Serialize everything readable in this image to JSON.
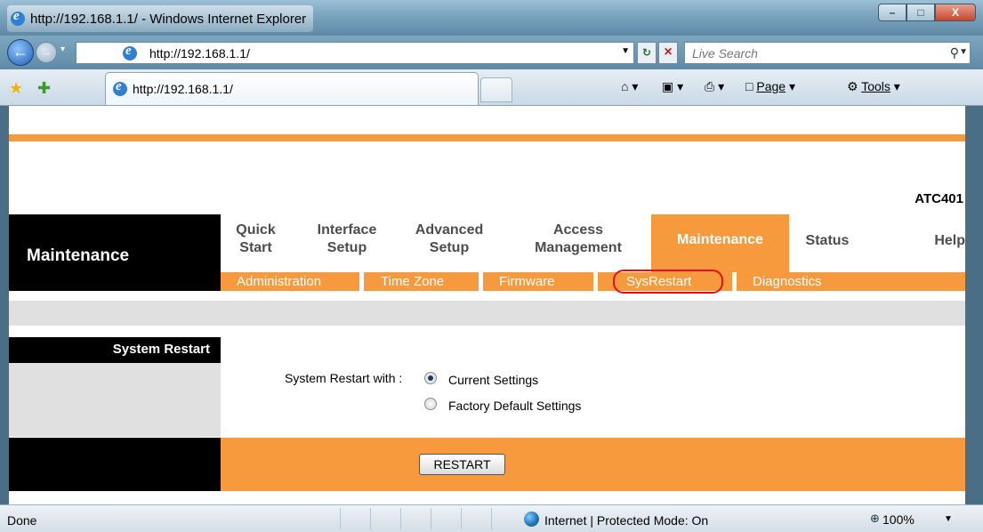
{
  "window": {
    "title": "http://192.168.1.1/ - Windows Internet Explorer",
    "btn_min": "–",
    "btn_max": "□",
    "btn_close": "X"
  },
  "address_bar": {
    "url": "http://192.168.1.1/",
    "search_placeholder": "Live Search"
  },
  "tab": {
    "label": "http://192.168.1.1/"
  },
  "command_bar": {
    "page": "Page",
    "tools": "Tools"
  },
  "router": {
    "model": "ATC401",
    "section": "Maintenance",
    "menu": [
      {
        "label": "Quick Start"
      },
      {
        "label": "Interface Setup"
      },
      {
        "label": "Advanced Setup"
      },
      {
        "label": "Access Management"
      },
      {
        "label": "Maintenance"
      },
      {
        "label": "Status"
      },
      {
        "label": "Help"
      }
    ],
    "submenu": [
      {
        "label": "Administration"
      },
      {
        "label": "Time Zone"
      },
      {
        "label": "Firmware"
      },
      {
        "label": "SysRestart"
      },
      {
        "label": "Diagnostics"
      }
    ],
    "panel_title": "System Restart",
    "option_label": "System Restart with :",
    "options": [
      {
        "label": "Current Settings",
        "checked": true
      },
      {
        "label": "Factory Default Settings",
        "checked": false
      }
    ],
    "restart_button": "RESTART"
  },
  "status_bar": {
    "status": "Done",
    "zone": "Internet | Protected Mode: On",
    "zoom": "100%"
  }
}
